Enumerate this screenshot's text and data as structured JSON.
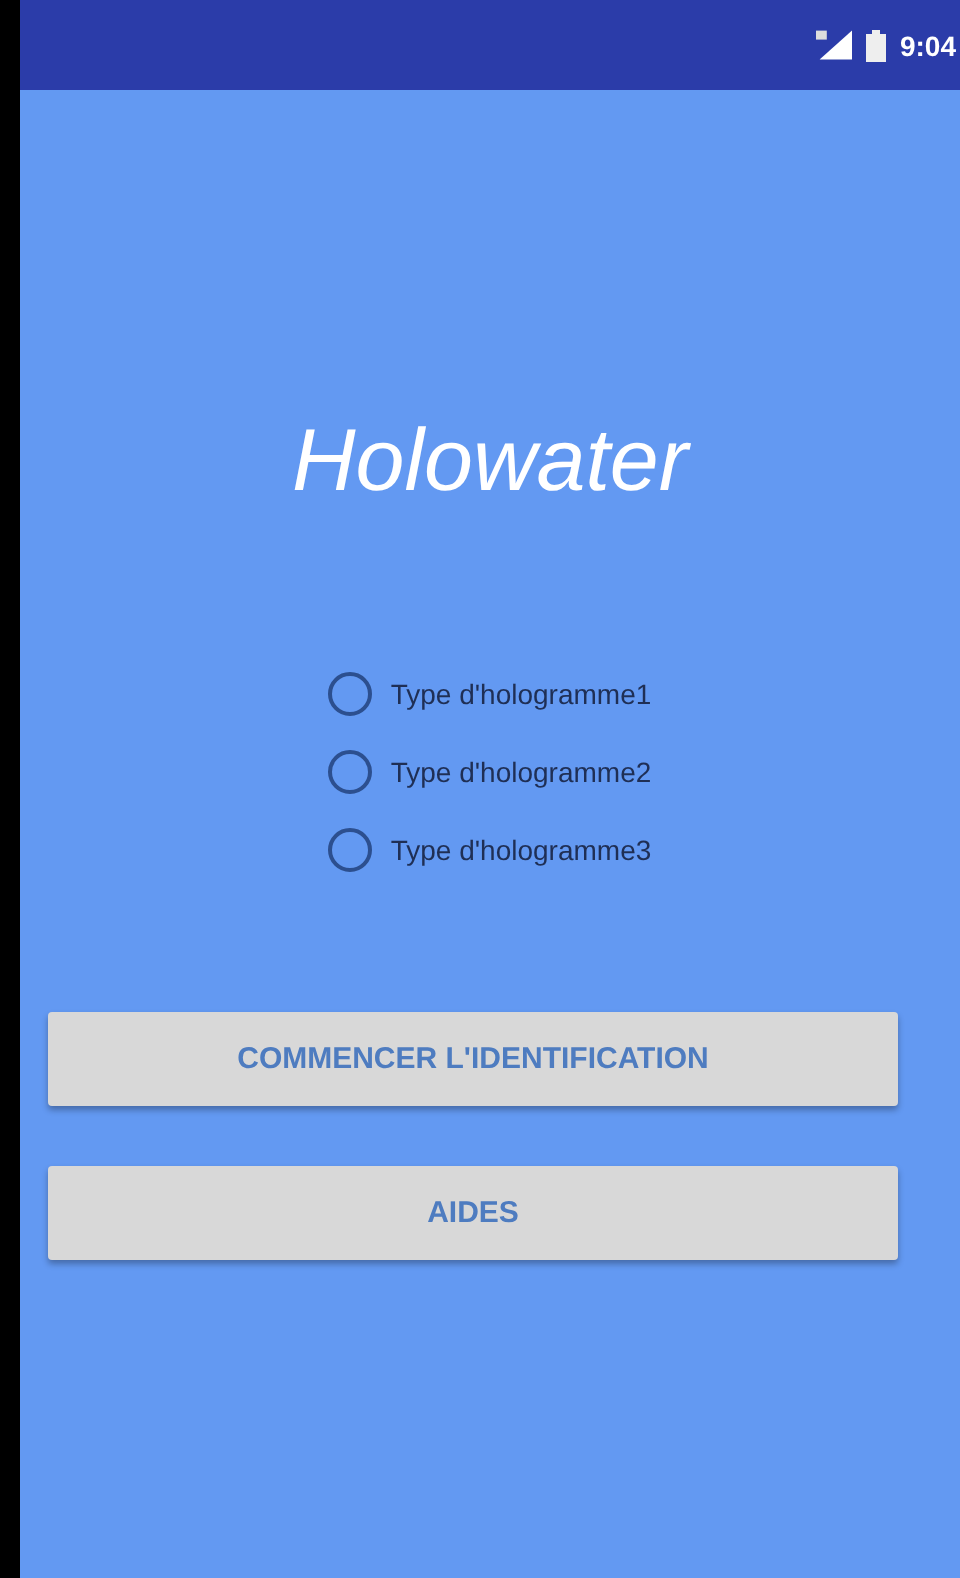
{
  "status_bar": {
    "time": "9:04"
  },
  "app": {
    "title": "Holowater"
  },
  "options": [
    {
      "label": "Type d'hologramme1",
      "selected": false
    },
    {
      "label": "Type d'hologramme2",
      "selected": false
    },
    {
      "label": "Type d'hologramme3",
      "selected": false
    }
  ],
  "buttons": [
    "COMMENCER L'IDENTIFICATION",
    "AIDES"
  ]
}
